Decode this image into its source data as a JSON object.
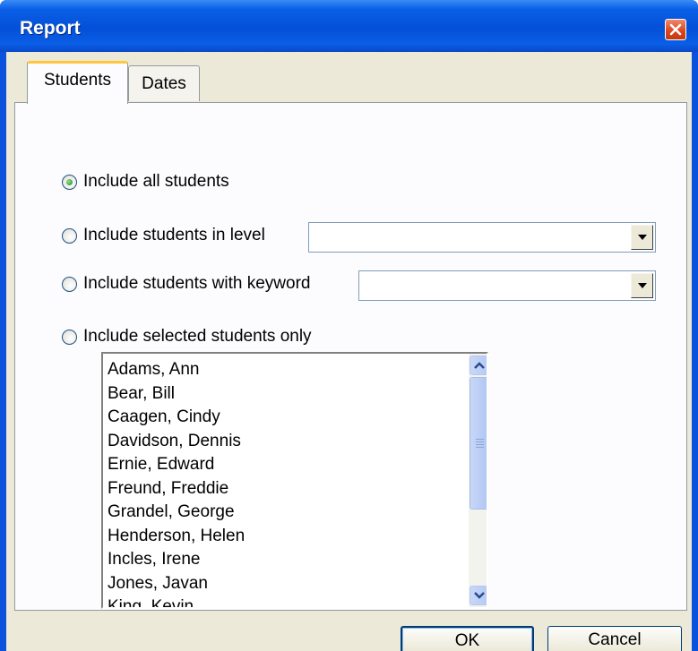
{
  "window": {
    "title": "Report"
  },
  "tabs": [
    {
      "label": "Students",
      "selected": true
    },
    {
      "label": "Dates",
      "selected": false
    }
  ],
  "options": [
    {
      "label": "Include all students",
      "checked": true
    },
    {
      "label": "Include students in level",
      "checked": false
    },
    {
      "label": "Include students with keyword",
      "checked": false
    },
    {
      "label": "Include selected students only",
      "checked": false
    }
  ],
  "level_combo": {
    "value": ""
  },
  "keyword_combo": {
    "value": ""
  },
  "students": [
    "Adams, Ann",
    "Bear, Bill",
    "Caagen, Cindy",
    "Davidson, Dennis",
    "Ernie, Edward",
    "Freund, Freddie",
    "Grandel, George",
    "Henderson, Helen",
    "Incles, Irene",
    "Jones, Javan",
    "King, Kevin"
  ],
  "buttons": {
    "ok": "OK",
    "cancel": "Cancel"
  },
  "icons": {
    "close": "close-icon",
    "combo_arrow": "chevron-down-icon",
    "scroll_up": "chevron-up-icon",
    "scroll_down": "chevron-down-icon"
  },
  "colors": {
    "titlebar": "#0a52dc",
    "face": "#ece9d8",
    "panel": "#fcfcfe",
    "tab_highlight": "#ffc83c"
  }
}
